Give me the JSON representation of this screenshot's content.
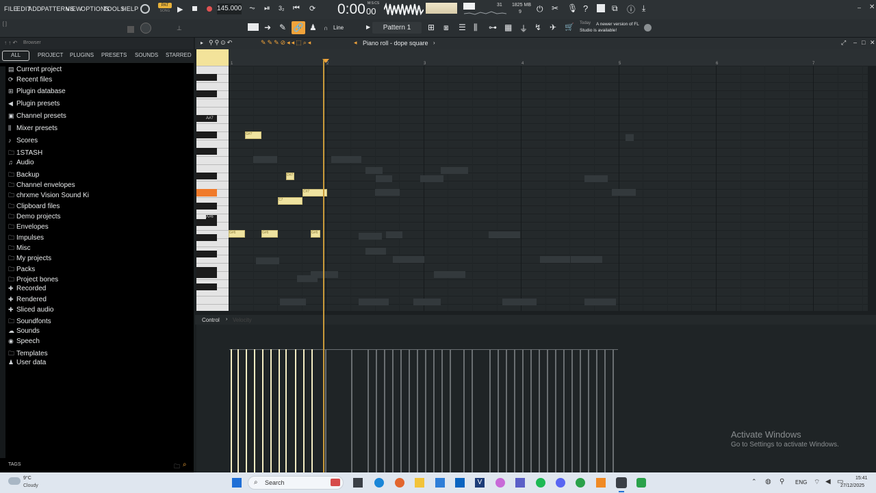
{
  "menu": [
    "FILE",
    "EDIT",
    "ADD",
    "PATTERNS",
    "VIEW",
    "OPTIONS",
    "TOOLS",
    "HELP"
  ],
  "transport": {
    "mode_badge": "PAT",
    "mode_sub": "SONG",
    "tempo": "145.000",
    "time": "0:00",
    "time_small": "00",
    "time_label": "M:S:CS",
    "mem": "1825 MB",
    "cpu": "31",
    "poly": "9"
  },
  "toolbar": {
    "snap": "Line",
    "pattern": "Pattern 1",
    "hint_title": "Today",
    "hint_text": "A newer version of FL Studio is available!"
  },
  "browser": {
    "title": "Browser",
    "tabs": [
      "ALL",
      "PROJECT",
      "PLUGINS",
      "PRESETS",
      "SOUNDS",
      "STARRED"
    ],
    "items": [
      "Current project",
      "Recent files",
      "Plugin database",
      "Plugin presets",
      "Channel presets",
      "Mixer presets",
      "Scores",
      "1STASH",
      "Audio",
      "Backup",
      "Channel envelopes",
      "chrxme Vision Sound Ki",
      "Clipboard files",
      "Demo projects",
      "Envelopes",
      "Impulses",
      "Misc",
      "My projects",
      "Packs",
      "Project bones",
      "Recorded",
      "Rendered",
      "Sliced audio",
      "Soundfonts",
      "Sounds",
      "Speech",
      "Templates",
      "User data"
    ],
    "tags_label": "TAGS"
  },
  "pianoroll": {
    "title": "Piano roll - dope square",
    "bar_numbers": [
      "2",
      "3",
      "4",
      "5",
      "6",
      "7"
    ],
    "key_labels": [
      "A#7",
      "A#6"
    ],
    "control_label": "Control",
    "control_target": "Velocity",
    "notes": [
      {
        "label": "G#7"
      },
      {
        "label": "D#7"
      },
      {
        "label": "C#7"
      },
      {
        "label": "C7"
      },
      {
        "label": "G#6"
      },
      {
        "label": "G#6"
      },
      {
        "label": "G#6"
      }
    ]
  },
  "watermark": {
    "title": "Activate Windows",
    "sub": "Go to Settings to activate Windows."
  },
  "taskbar": {
    "weather_temp": "9°C",
    "weather_desc": "Cloudy",
    "search": "Search",
    "lang": "ENG",
    "time": "15:41",
    "date": "27/12/2025"
  },
  "colors": {
    "accent": "#f0a33a",
    "note": "#efe3a0",
    "playhead": "#c99a3a"
  }
}
